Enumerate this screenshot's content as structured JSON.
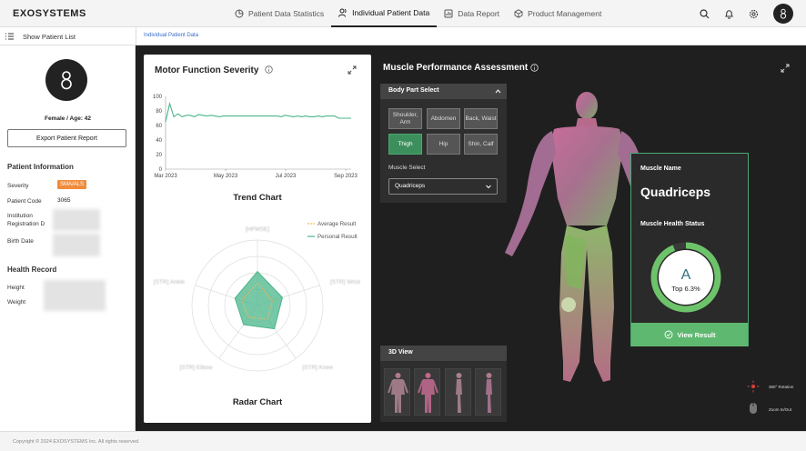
{
  "app": {
    "logo": "EXOSYSTEMS"
  },
  "nav": {
    "items": [
      {
        "label": "Patient Data Statistics"
      },
      {
        "label": "Individual Patient Data"
      },
      {
        "label": "Data Report"
      },
      {
        "label": "Product Management"
      }
    ],
    "active": "Individual Patient Data"
  },
  "subbar": {
    "show_list": "Show Patient List",
    "breadcrumb": "Individual Patient Data"
  },
  "sidebar": {
    "gender_age": "Female / Age: 42",
    "export_button": "Export Patient Report",
    "patient_info_title": "Patient Information",
    "severity_label": "Severity",
    "severity_value": "SMA/ALS",
    "patient_code_label": "Patient Code",
    "patient_code_value": "3065",
    "institution_label": "Institution Registration D",
    "birth_date_label": "Birth Date",
    "health_record_title": "Health Record",
    "height_label": "Height",
    "weight_label": "Weight"
  },
  "motor_card": {
    "title": "Motor Function Severity",
    "trend_title": "Trend Chart",
    "radar_title": "Radar Chart"
  },
  "chart_data": [
    {
      "type": "line",
      "title": "Trend Chart",
      "x_ticks": [
        "Mar 2023",
        "May 2023",
        "Jul 2023",
        "Sep 2023"
      ],
      "ylim": [
        0,
        100
      ],
      "y_ticks": [
        0,
        20,
        40,
        60,
        80,
        100
      ],
      "series": [
        {
          "color": "#4ab58a",
          "values": [
            65,
            90,
            72,
            76,
            72,
            74,
            74,
            72,
            75,
            74,
            73,
            74,
            73,
            72,
            73,
            73,
            73,
            73,
            73,
            73,
            73,
            73,
            73,
            73,
            73,
            73,
            73,
            73,
            72,
            74,
            73,
            72,
            73,
            72,
            73,
            72,
            72,
            73,
            72,
            73,
            73,
            73,
            70,
            70,
            70,
            70
          ]
        }
      ]
    },
    {
      "type": "radar",
      "title": "Radar Chart",
      "axes": [
        "[HFMSE]",
        "[STR] Wrist",
        "[STR] Knee",
        "[STR] Elbow",
        "[STR] Ankle"
      ],
      "legend": [
        "Average Result",
        "Personal Result"
      ],
      "rmax": 100,
      "series": [
        {
          "name": "Average Result",
          "color": "#e8b95a",
          "values": [
            34,
            24,
            26,
            22,
            26
          ]
        },
        {
          "name": "Personal Result",
          "color": "#4ab58a",
          "values": [
            52,
            40,
            44,
            36,
            36
          ]
        }
      ]
    }
  ],
  "muscle_panel": {
    "title": "Muscle Performance Assessment",
    "body_part_title": "Body Part Select",
    "body_parts": [
      "Shoulder, Arm",
      "Abdomen",
      "Back, Waist",
      "Thigh",
      "Hip",
      "Shin, Calf"
    ],
    "active_body_part": "Thigh",
    "muscle_select_label": "Muscle Select",
    "muscle_select_value": "Quadriceps",
    "view_3d_title": "3D View",
    "hint_rotation": "360° Rotation",
    "hint_zoom": "Zoom In/Out"
  },
  "muscle_card": {
    "name_label": "Muscle Name",
    "name_value": "Quadriceps",
    "health_label": "Muscle Health Status",
    "grade": "A",
    "percentile": "Top 6.3%",
    "percentile_fraction": 0.937,
    "view_button": "View Result"
  },
  "colors": {
    "accent_green": "#4aa870",
    "badge_orange": "#f08c3c"
  },
  "footer": {
    "copyright": "Copyright © 2024 EXOSYSTEMS Inc. All rights reserved."
  }
}
